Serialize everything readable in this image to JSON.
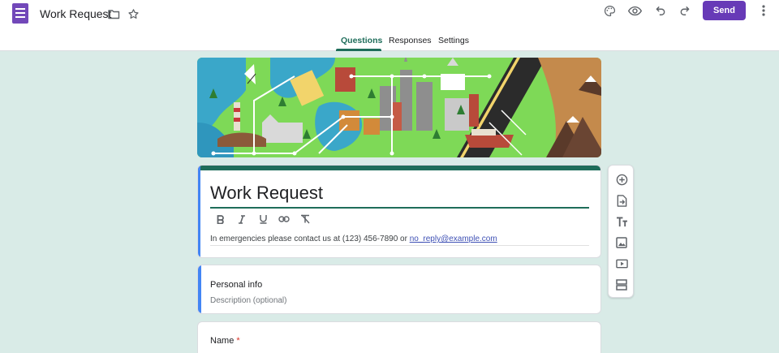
{
  "app": {
    "doc_title": "Work Request",
    "send_label": "Send"
  },
  "icons": {
    "app_logo": "forms-logo-icon",
    "folder": "folder-icon",
    "star": "star-icon",
    "palette": "palette-icon",
    "preview": "eye-icon",
    "undo": "undo-icon",
    "redo": "redo-icon",
    "more": "more-vert-icon"
  },
  "tabs": [
    {
      "label": "Questions",
      "active": true
    },
    {
      "label": "Responses",
      "active": false
    },
    {
      "label": "Settings",
      "active": false
    }
  ],
  "form": {
    "title": "Work Request",
    "description_text": "In emergencies please contact us at (123) 456-7890 or ",
    "description_link": "no_reply@example.com"
  },
  "section": {
    "title": "Personal info",
    "description_placeholder": "Description (optional)"
  },
  "question": {
    "title": "Name",
    "required_mark": "*"
  },
  "format_toolbar": [
    "bold-icon",
    "italic-icon",
    "underline-icon",
    "link-icon",
    "clear-format-icon"
  ],
  "side_toolbar": [
    "add-question-icon",
    "import-questions-icon",
    "add-title-icon",
    "add-image-icon",
    "add-video-icon",
    "add-section-icon"
  ],
  "colors": {
    "accent": "#1e6d5a",
    "brand": "#673ab7",
    "background": "#d9ebe7",
    "required": "#d93025"
  }
}
